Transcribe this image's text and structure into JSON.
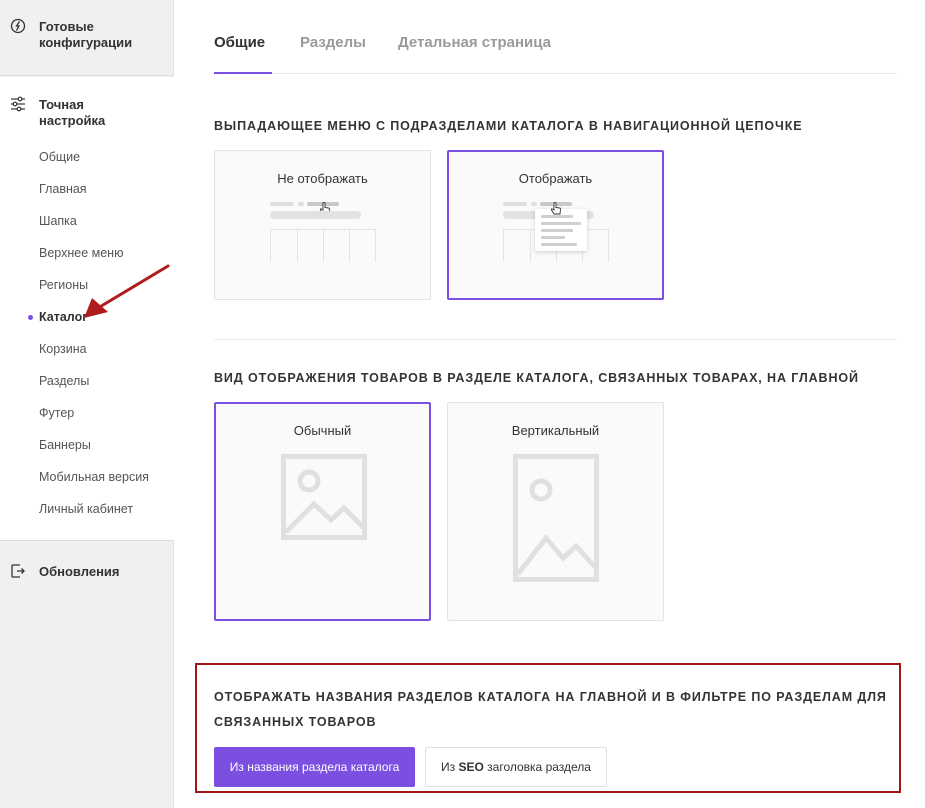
{
  "sidebar": {
    "ready_configs": "Готовые конфигурации",
    "fine_tuning": "Точная настройка",
    "items": [
      {
        "label": "Общие"
      },
      {
        "label": "Главная"
      },
      {
        "label": "Шапка"
      },
      {
        "label": "Верхнее меню"
      },
      {
        "label": "Регионы"
      },
      {
        "label": "Каталог",
        "active": true
      },
      {
        "label": "Корзина"
      },
      {
        "label": "Разделы"
      },
      {
        "label": "Футер"
      },
      {
        "label": "Баннеры"
      },
      {
        "label": "Мобильная версия"
      },
      {
        "label": "Личный кабинет"
      }
    ],
    "updates": "Обновления"
  },
  "tabs": [
    {
      "label": "Общие",
      "active": true
    },
    {
      "label": "Разделы",
      "active": false
    },
    {
      "label": "Детальная страница",
      "active": false
    }
  ],
  "sections": {
    "breadcrumb_dropdown": {
      "title": "Выпадающее меню с подразделами каталога в навигационной цепочке",
      "options": [
        {
          "label": "Не отображать",
          "selected": false
        },
        {
          "label": "Отображать",
          "selected": true
        }
      ]
    },
    "product_view": {
      "title": "Вид отображения товаров в разделе каталога, связанных товарах, на главной",
      "options": [
        {
          "label": "Обычный",
          "selected": true
        },
        {
          "label": "Вертикальный",
          "selected": false
        }
      ]
    },
    "section_names": {
      "title_line1": "Отображать названия разделов каталога на главной и в фильтре по разделам для",
      "title_line2": "связанных товаров",
      "options": [
        {
          "label": "Из названия раздела каталога",
          "selected": true
        },
        {
          "label_prefix": "Из ",
          "label_bold": "SEO",
          "label_suffix": " заголовка раздела",
          "selected": false
        }
      ]
    }
  },
  "colors": {
    "accent": "#7b4fe0",
    "highlight": "#a31515",
    "arrow": "#b01c1c"
  },
  "icons": [
    "ready-configs-icon",
    "sliders-icon",
    "updates-icon",
    "hand-pointer-icon",
    "image-placeholder-icon",
    "arrow-annotation"
  ]
}
